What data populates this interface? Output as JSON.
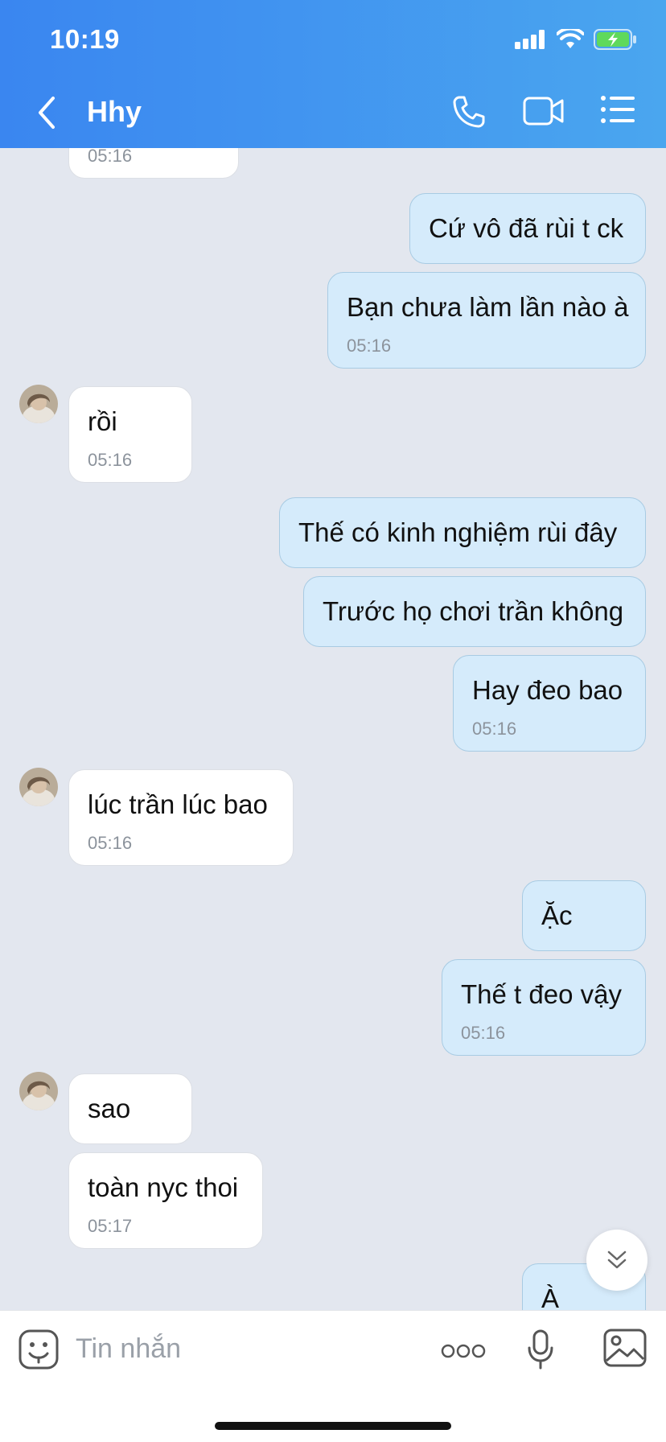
{
  "status_bar": {
    "time": "10:19"
  },
  "header": {
    "contact_name": "Hhy",
    "back_icon": "chevron-left-icon",
    "call_icon": "phone-icon",
    "video_icon": "video-camera-icon",
    "menu_icon": "list-icon"
  },
  "messages": [
    {
      "dir": "in",
      "text": "",
      "time": "05:16"
    },
    {
      "dir": "out",
      "text": "Cứ vô đã rùi t ck",
      "time": ""
    },
    {
      "dir": "out",
      "text": "Bạn chưa làm lần nào à",
      "time": "05:16"
    },
    {
      "dir": "in",
      "text": "rồi",
      "time": "05:16"
    },
    {
      "dir": "out",
      "text": "Thế có kinh nghiệm rùi đây",
      "time": ""
    },
    {
      "dir": "out",
      "text": "Trước họ chơi trần không",
      "time": ""
    },
    {
      "dir": "out",
      "text": "Hay đeo bao",
      "time": "05:16"
    },
    {
      "dir": "in",
      "text": "lúc trần lúc bao",
      "time": "05:16"
    },
    {
      "dir": "out",
      "text": "Ặc",
      "time": ""
    },
    {
      "dir": "out",
      "text": "Thế t đeo vậy",
      "time": "05:16"
    },
    {
      "dir": "in",
      "text": "sao",
      "time": ""
    },
    {
      "dir": "in",
      "text": "toàn nyc thoi",
      "time": "05:17"
    },
    {
      "dir": "out",
      "text": "À",
      "time": ""
    }
  ],
  "input": {
    "placeholder": "Tin nhắn",
    "emoji_icon": "emoji-icon",
    "more_icon": "more-dots-icon",
    "mic_icon": "microphone-icon",
    "image_icon": "image-icon"
  },
  "colors": {
    "header_start": "#3a86f0",
    "header_end": "#4aa6ef",
    "outgoing_bubble": "#d5ebfb",
    "incoming_bubble": "#ffffff",
    "chat_bg": "#e3e7ef"
  }
}
